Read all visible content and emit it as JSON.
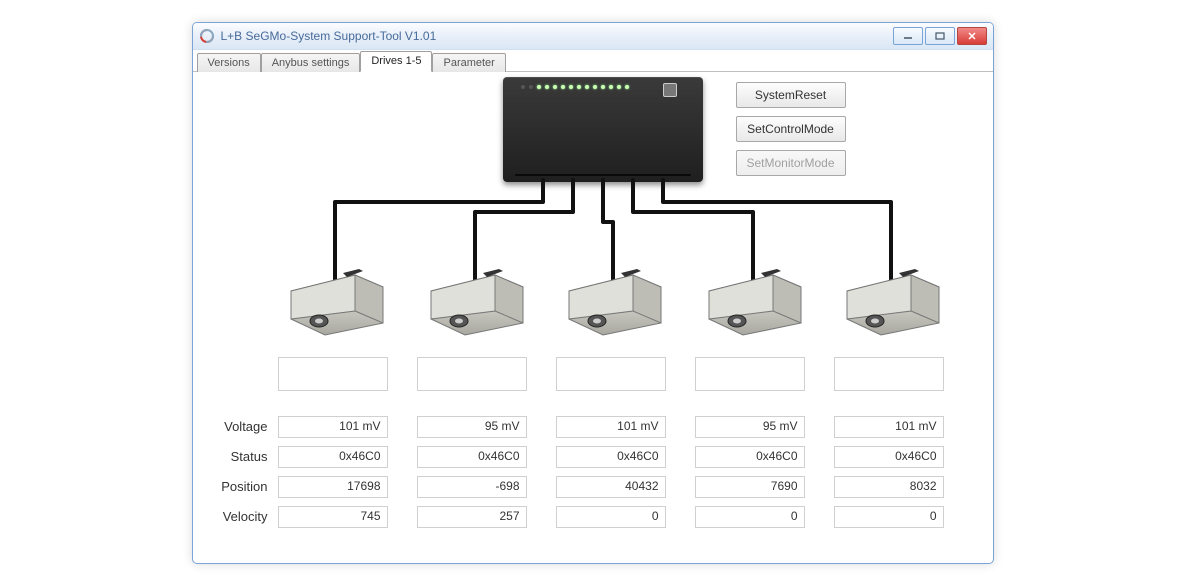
{
  "window": {
    "title": "L+B SeGMo-System Support-Tool V1.01"
  },
  "tabs": [
    {
      "label": "Versions",
      "active": false
    },
    {
      "label": "Anybus settings",
      "active": false
    },
    {
      "label": "Drives 1-5",
      "active": true
    },
    {
      "label": "Parameter",
      "active": false
    }
  ],
  "buttons": {
    "system_reset": "SystemReset",
    "set_control_mode": "SetControlMode",
    "set_monitor_mode": "SetMonitorMode",
    "set_monitor_mode_disabled": true
  },
  "row_labels": {
    "voltage": "Voltage",
    "status": "Status",
    "position": "Position",
    "velocity": "Velocity"
  },
  "drives": [
    {
      "voltage": "101 mV",
      "status": "0x46C0",
      "position": "17698",
      "velocity": "745"
    },
    {
      "voltage": "95 mV",
      "status": "0x46C0",
      "position": "-698",
      "velocity": "257"
    },
    {
      "voltage": "101 mV",
      "status": "0x46C0",
      "position": "40432",
      "velocity": "0"
    },
    {
      "voltage": "95 mV",
      "status": "0x46C0",
      "position": "7690",
      "velocity": "0"
    },
    {
      "voltage": "101 mV",
      "status": "0x46C0",
      "position": "8032",
      "velocity": "0"
    }
  ],
  "colors": {
    "titlebar_text": "#486a99",
    "close_button": "#d93c36"
  }
}
